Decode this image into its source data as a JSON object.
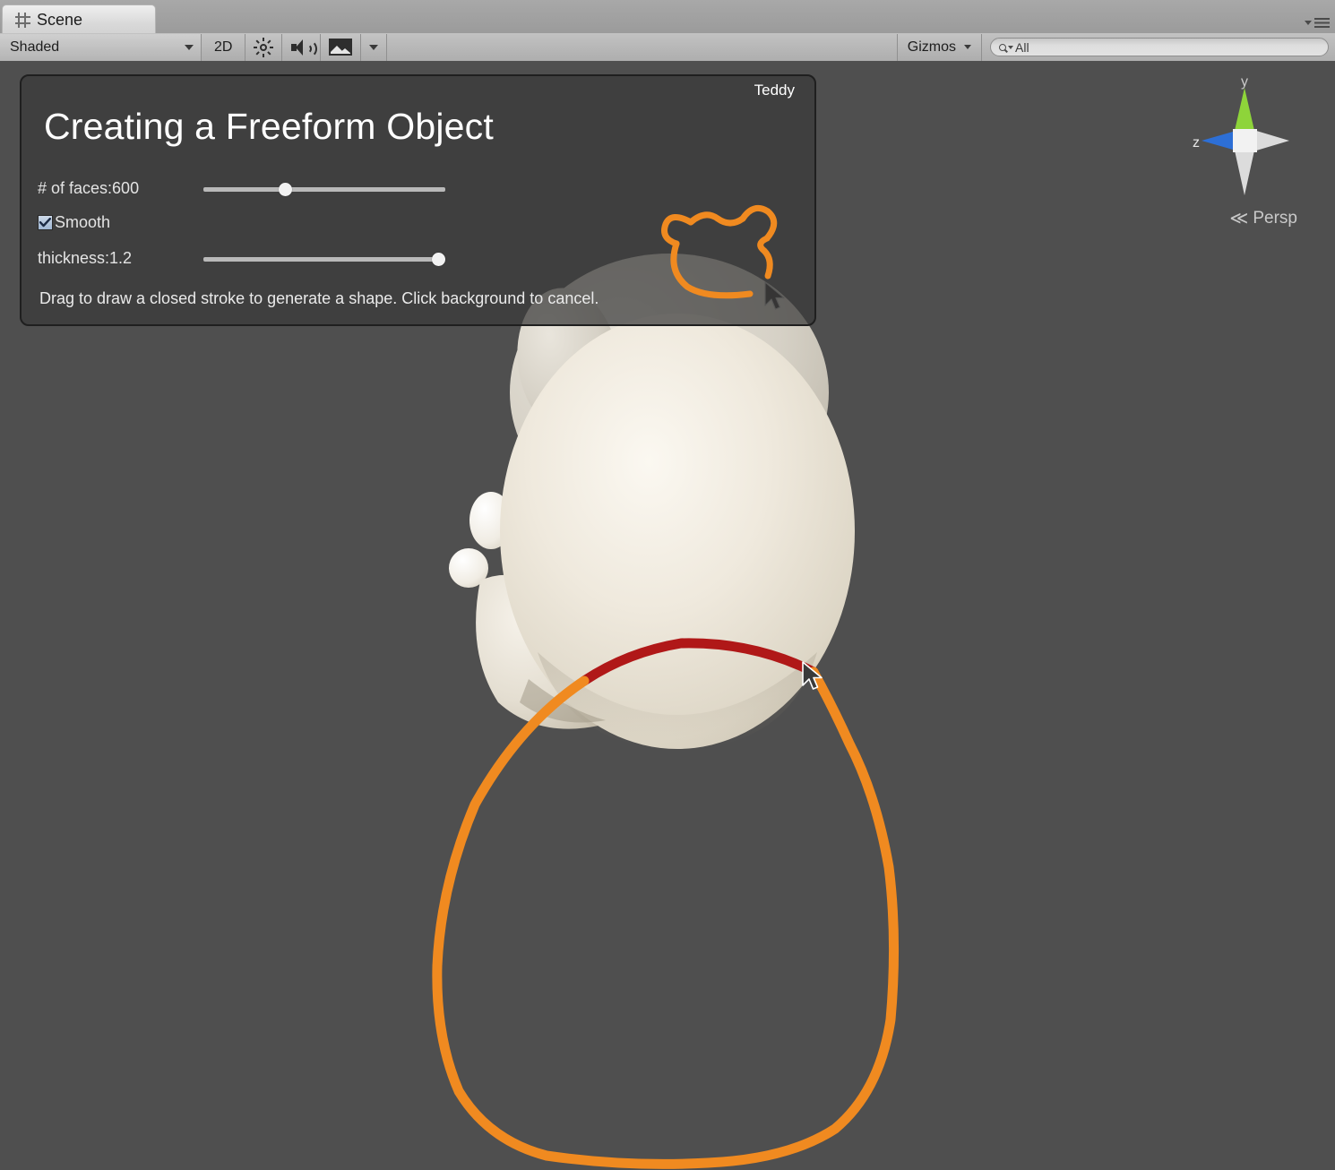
{
  "window": {
    "tab_label": "Scene",
    "tab_icon": "grid-hash-icon",
    "menu_icon": "window-menu-icon"
  },
  "toolbar": {
    "shading_mode": "Shaded",
    "mode_2d": "2D",
    "lighting_icon": "sun-icon",
    "audio_icon": "speaker-icon",
    "fx_icon": "image-effects-icon",
    "fx_caret": "chevron-down-icon",
    "gizmos_label": "Gizmos",
    "gizmos_caret": "chevron-down-icon",
    "search_value": "All",
    "search_icon": "search-icon"
  },
  "teddy_panel": {
    "tool_name": "Teddy",
    "title": "Creating a Freeform Object",
    "faces_label": "# of faces:600",
    "faces_value": 600,
    "faces_slider_percent": 33,
    "smooth_label": "Smooth",
    "smooth_checked": true,
    "thickness_label": "thickness:1.2",
    "thickness_value": 1.2,
    "thickness_slider_percent": 100,
    "hint": "Drag to draw a closed stroke to generate a shape. Click background to cancel.",
    "bear_icon": "bear-outline-icon",
    "cursor_icon": "pointer-cursor-icon"
  },
  "axis_gizmo": {
    "y_label": "y",
    "z_label": "z",
    "projection_label": "Persp",
    "projection_arrow": "≪",
    "y_color": "#8ed43a",
    "z_color": "#2d6fd6",
    "neutral_color": "#dcdcdc"
  },
  "scene": {
    "background_color": "#4f4f4f",
    "stroke_color": "#f08a20",
    "stroke_occluded_color": "#b01818",
    "model_color": "#e8e2d6",
    "cursor_icon": "pointer-cursor-icon"
  }
}
